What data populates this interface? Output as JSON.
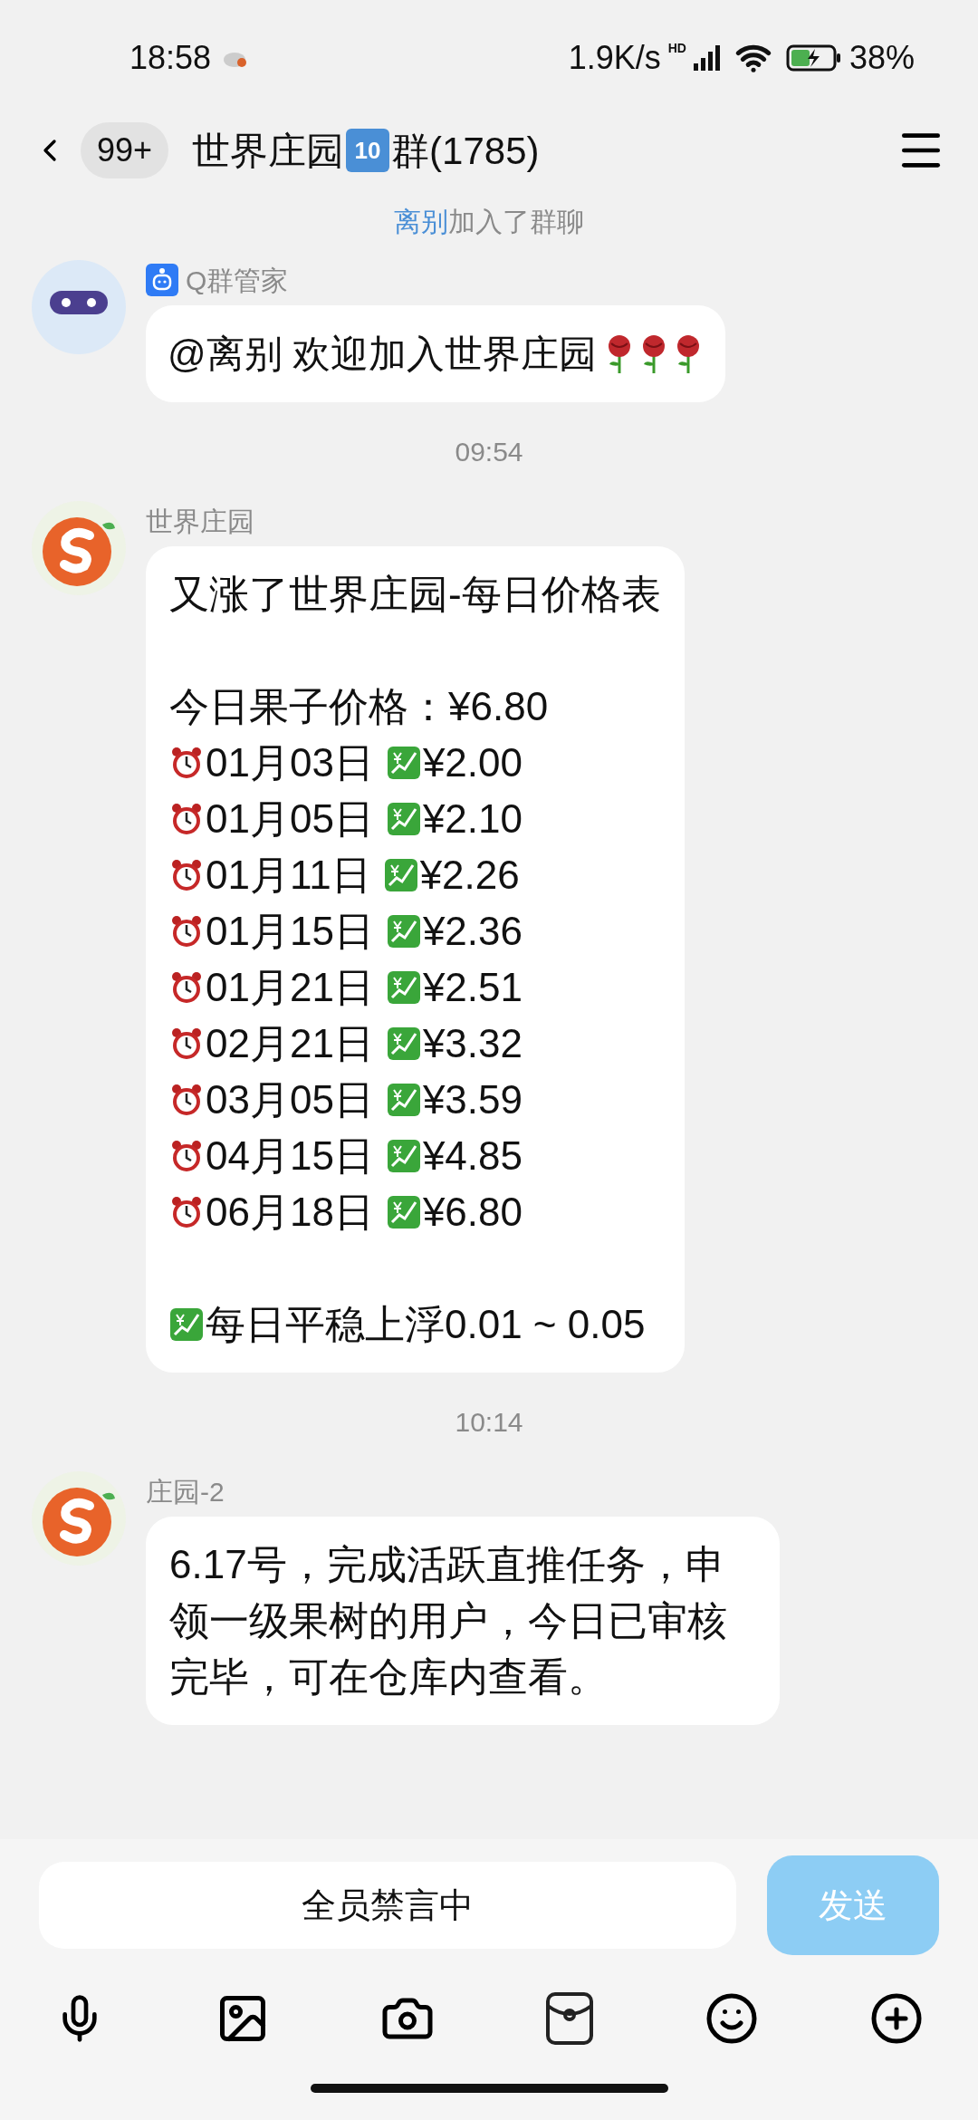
{
  "status_bar": {
    "time": "18:58",
    "speed": "1.9K/s",
    "network": "HD",
    "battery": "38%"
  },
  "header": {
    "unread": "99+",
    "title_before": "世界庄园",
    "keycap": "10",
    "title_after": "群(1785)"
  },
  "notice": {
    "name": "离别",
    "text": "加入了群聊"
  },
  "messages": [
    {
      "kind": "bot",
      "sender": "Q群管家",
      "text": "@离别 欢迎加入世界庄园",
      "emojis": [
        {
          "kind": "rose"
        },
        {
          "kind": "rose"
        },
        {
          "kind": "rose"
        }
      ]
    },
    {
      "kind": "time",
      "text": "09:54"
    },
    {
      "kind": "table",
      "sender": "世界庄园",
      "title": "又涨了世界庄园-每日价格表",
      "today": "今日果子价格：¥6.80",
      "rows": [
        {
          "date": "01月03日",
          "price": "¥2.00"
        },
        {
          "date": "01月05日",
          "price": "¥2.10"
        },
        {
          "date": "01月11日",
          "price": "¥2.26"
        },
        {
          "date": "01月15日",
          "price": "¥2.36"
        },
        {
          "date": "01月21日",
          "price": "¥2.51"
        },
        {
          "date": "02月21日",
          "price": "¥3.32"
        },
        {
          "date": "03月05日",
          "price": "¥3.59"
        },
        {
          "date": "04月15日",
          "price": "¥4.85"
        },
        {
          "date": "06月18日",
          "price": "¥6.80"
        }
      ],
      "footer": "每日平稳上浮0.01 ~ 0.05"
    },
    {
      "kind": "time",
      "text": "10:14"
    },
    {
      "kind": "text",
      "sender": "庄园-2",
      "text": "6.17号，完成活跃直推任务，申领一级果树的用户，今日已审核完毕，可在仓库内查看。"
    }
  ],
  "input": {
    "placeholder": "全员禁言中",
    "send": "发送",
    "disabled": true
  }
}
